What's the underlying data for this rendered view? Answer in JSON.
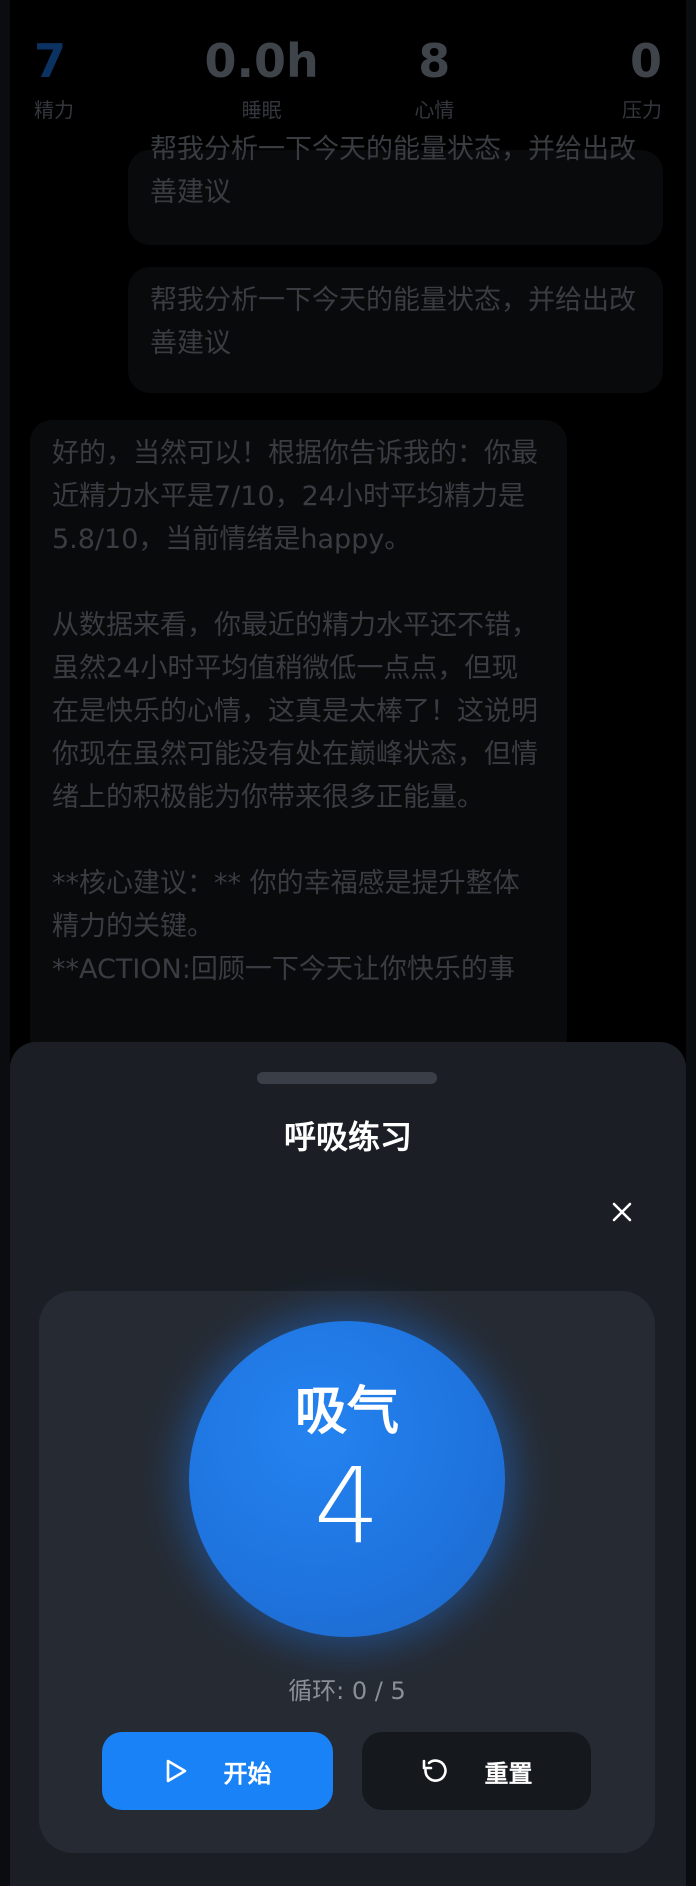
{
  "stats": [
    {
      "value": "7",
      "label": "精力"
    },
    {
      "value": "0.0h",
      "label": "睡眠"
    },
    {
      "value": "8",
      "label": "心情"
    },
    {
      "value": "0",
      "label": "压力"
    }
  ],
  "chat": {
    "user_message_1": "帮我分析一下今天的能量状态，并给出改善建议",
    "user_message_2": "帮我分析一下今天的能量状态，并给出改善建议",
    "assistant_message": "好的，当然可以！根据你告诉我的：你最近精力水平是7/10，24小时平均精力是5.8/10，当前情绪是happy。\n\n从数据来看，你最近的精力水平还不错，虽然24小时平均值稍微低一点点，但现在是快乐的心情，这真是太棒了！这说明你现在虽然可能没有处在巅峰状态，但情绪上的积极能为你带来很多正能量。\n\n**核心建议：** 你的幸福感是提升整体精力的关键。\n**ACTION:回顾一下今天让你快乐的事"
  },
  "sheet": {
    "title": "呼吸练习",
    "phase": "吸气",
    "count": "4",
    "cycle_text": "循环: 0 / 5",
    "start_label": "开始",
    "reset_label": "重置"
  },
  "colors": {
    "accent": "#1a82f7",
    "circle": "#1f74df",
    "sheet_bg": "#1b1f25",
    "card_bg": "#262b33"
  },
  "icons": {
    "close": "close-icon",
    "play": "play-icon",
    "reset": "reset-icon"
  }
}
